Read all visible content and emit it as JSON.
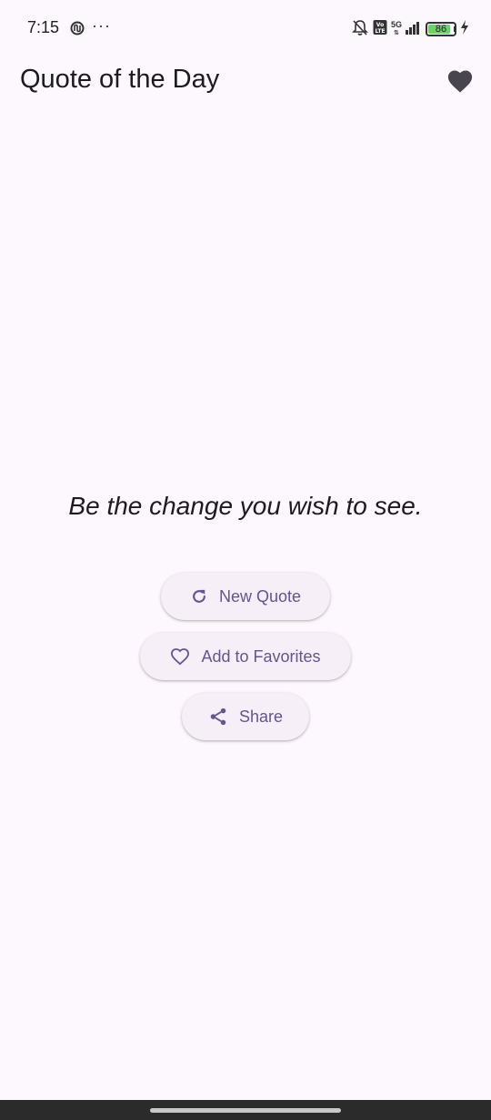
{
  "status_bar": {
    "time": "7:15",
    "dots": "···",
    "network": "5G",
    "volte": "Vo",
    "battery_level": "86",
    "battery_fraction": 0.86,
    "icons": [
      "app-notification-icon",
      "mute-bell-icon",
      "volte-icon",
      "signal-icon",
      "battery-icon",
      "charging-icon"
    ]
  },
  "app_bar": {
    "title": "Quote of the Day",
    "favorites_icon": "heart-filled-icon"
  },
  "quote": {
    "text": "Be the change you wish to see."
  },
  "buttons": {
    "new_quote": {
      "label": "New Quote",
      "icon": "refresh-icon"
    },
    "add_favorites": {
      "label": "Add to Favorites",
      "icon": "heart-outline-icon"
    },
    "share": {
      "label": "Share",
      "icon": "share-icon"
    }
  },
  "colors": {
    "background": "#fdf7fe",
    "accent": "#65558f",
    "button_bg": "#f6eff7",
    "text": "#1d1b20",
    "heart": "#49454f"
  }
}
